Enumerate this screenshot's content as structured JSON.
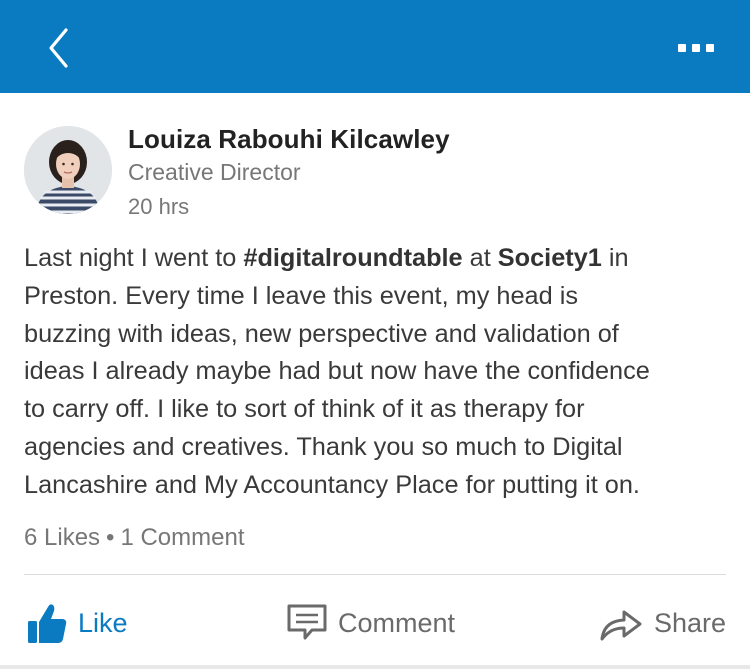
{
  "topbar": {
    "back_icon": "chevron-left-icon",
    "more_icon": "more-horizontal-icon",
    "background": "#0a7bc1"
  },
  "post": {
    "author": {
      "name": "Louiza Rabouhi Kilcawley",
      "title": "Creative Director",
      "time": "20 hrs"
    },
    "body_lines": [
      [
        {
          "text": "Last night I went to ",
          "bold": false
        },
        {
          "text": "#digitalroundtable",
          "bold": true
        },
        {
          "text": " at ",
          "bold": false
        },
        {
          "text": "Society1",
          "bold": true
        },
        {
          "text": " in",
          "bold": false
        }
      ],
      [
        {
          "text": "Preston. Every time I leave this event, my head is",
          "bold": false
        }
      ],
      [
        {
          "text": "buzzing with ideas, new perspective and validation of",
          "bold": false
        }
      ],
      [
        {
          "text": "ideas I already maybe had but now have the confidence",
          "bold": false
        }
      ],
      [
        {
          "text": "to carry off. I like to sort of think of it as therapy for",
          "bold": false
        }
      ],
      [
        {
          "text": "agencies and creatives.  Thank you so much to Digital",
          "bold": false
        }
      ],
      [
        {
          "text": "Lancashire and My Accountancy Place for putting it on.",
          "bold": false
        }
      ]
    ],
    "stats": {
      "likes": "6 Likes",
      "separator": "•",
      "comments": "1 Comment"
    }
  },
  "actions": {
    "like_label": "Like",
    "comment_label": "Comment",
    "share_label": "Share",
    "like_icon": "thumbs-up-icon",
    "comment_icon": "comment-icon",
    "share_icon": "share-icon",
    "like_color": "#0a7bc1"
  }
}
